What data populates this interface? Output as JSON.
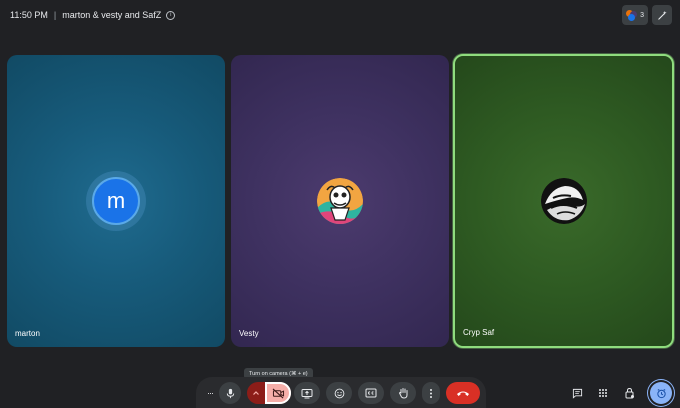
{
  "topbar": {
    "time": "11:50 PM",
    "separator": "|",
    "meeting_name": "marton & vesty and SafZ",
    "info_icon": "i",
    "participant_count": "3"
  },
  "tiles": [
    {
      "name": "marton",
      "avatar_letter": "m"
    },
    {
      "name": "Vesty"
    },
    {
      "name": "Cryp Saf"
    }
  ],
  "tooltip": {
    "text": "Turn on camera (⌘ + e)"
  },
  "toolbar": {
    "more_options_label": "···"
  },
  "colors": {
    "background": "#202124",
    "active_speaker_border": "#8fdc7e",
    "end_call": "#d93025",
    "camera_off": "#f6aea9",
    "accent": "#8ab4f8"
  },
  "icons": [
    "info-icon",
    "people-icon",
    "effects-icon",
    "more-options-icon",
    "microphone-icon",
    "chevron-up-icon",
    "camera-off-icon",
    "present-screen-icon",
    "emoji-icon",
    "captions-icon",
    "raise-hand-icon",
    "more-vert-icon",
    "end-call-icon",
    "chat-icon",
    "apps-icon",
    "host-controls-icon",
    "activities-icon"
  ]
}
